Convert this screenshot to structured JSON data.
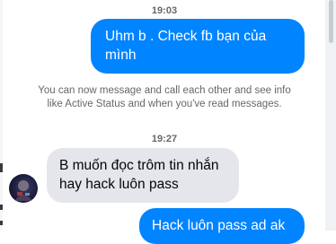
{
  "conversation": {
    "messages": [
      {
        "timestamp": "19:03",
        "direction": "outgoing",
        "text": "Uhm b . Check fb bạn của mình"
      },
      {
        "direction": "system",
        "text": "You can now message and call each other and see info like Active Status and when you've read messages."
      },
      {
        "timestamp": "19:27",
        "direction": "incoming",
        "text": "B muốn đọc trôm tin nhắn hay hack luôn pass"
      },
      {
        "direction": "outgoing",
        "text": "Hack luôn pass ad ak"
      }
    ]
  },
  "colors": {
    "outgoing_bubble": "#0084ff",
    "incoming_bubble": "#e4e6eb",
    "timestamp_text": "#65676b"
  }
}
